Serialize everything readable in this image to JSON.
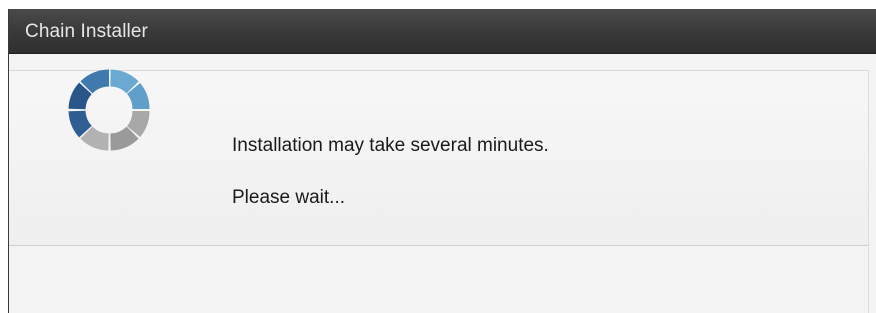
{
  "window": {
    "title": "Chain Installer"
  },
  "main": {
    "spinner_icon": "loading-spinner-icon",
    "message": "Installation may take several minutes.",
    "wait_text": "Please wait..."
  },
  "colors": {
    "titlebar": "#3a3a3a",
    "title_text": "#e6e6e6",
    "spinner_blue_dark": "#2f5f92",
    "spinner_blue_light": "#5f9fc9",
    "spinner_gray": "#9a9a9a",
    "spinner_gray_light": "#bdbdbd"
  }
}
